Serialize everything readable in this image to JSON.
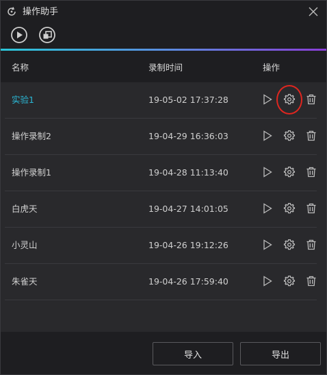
{
  "window": {
    "title": "操作助手"
  },
  "icons": {
    "app": "refresh-icon",
    "close": "close-icon",
    "play_all": "play-circle-icon",
    "record": "record-square-icon",
    "play": "play-icon",
    "settings": "gear-icon",
    "delete": "trash-icon"
  },
  "table": {
    "headers": {
      "name": "名称",
      "time": "录制时间",
      "actions": "操作"
    },
    "rows": [
      {
        "name": "实验1",
        "time": "19-05-02 17:37:28",
        "active": true
      },
      {
        "name": "操作录制2",
        "time": "19-04-29 16:36:03",
        "active": false
      },
      {
        "name": "操作录制1",
        "time": "19-04-28 11:13:40",
        "active": false
      },
      {
        "name": "白虎天",
        "time": "19-04-27 14:01:05",
        "active": false
      },
      {
        "name": "小灵山",
        "time": "19-04-26 19:12:26",
        "active": false
      },
      {
        "name": "朱雀天",
        "time": "19-04-26 17:59:40",
        "active": false
      }
    ]
  },
  "footer": {
    "import_label": "导入",
    "export_label": "导出"
  },
  "colors": {
    "accent": "#2bb8d6",
    "gradient_start": "#2bc6d8",
    "gradient_end": "#8a3ed8",
    "highlight": "#e0261f"
  }
}
